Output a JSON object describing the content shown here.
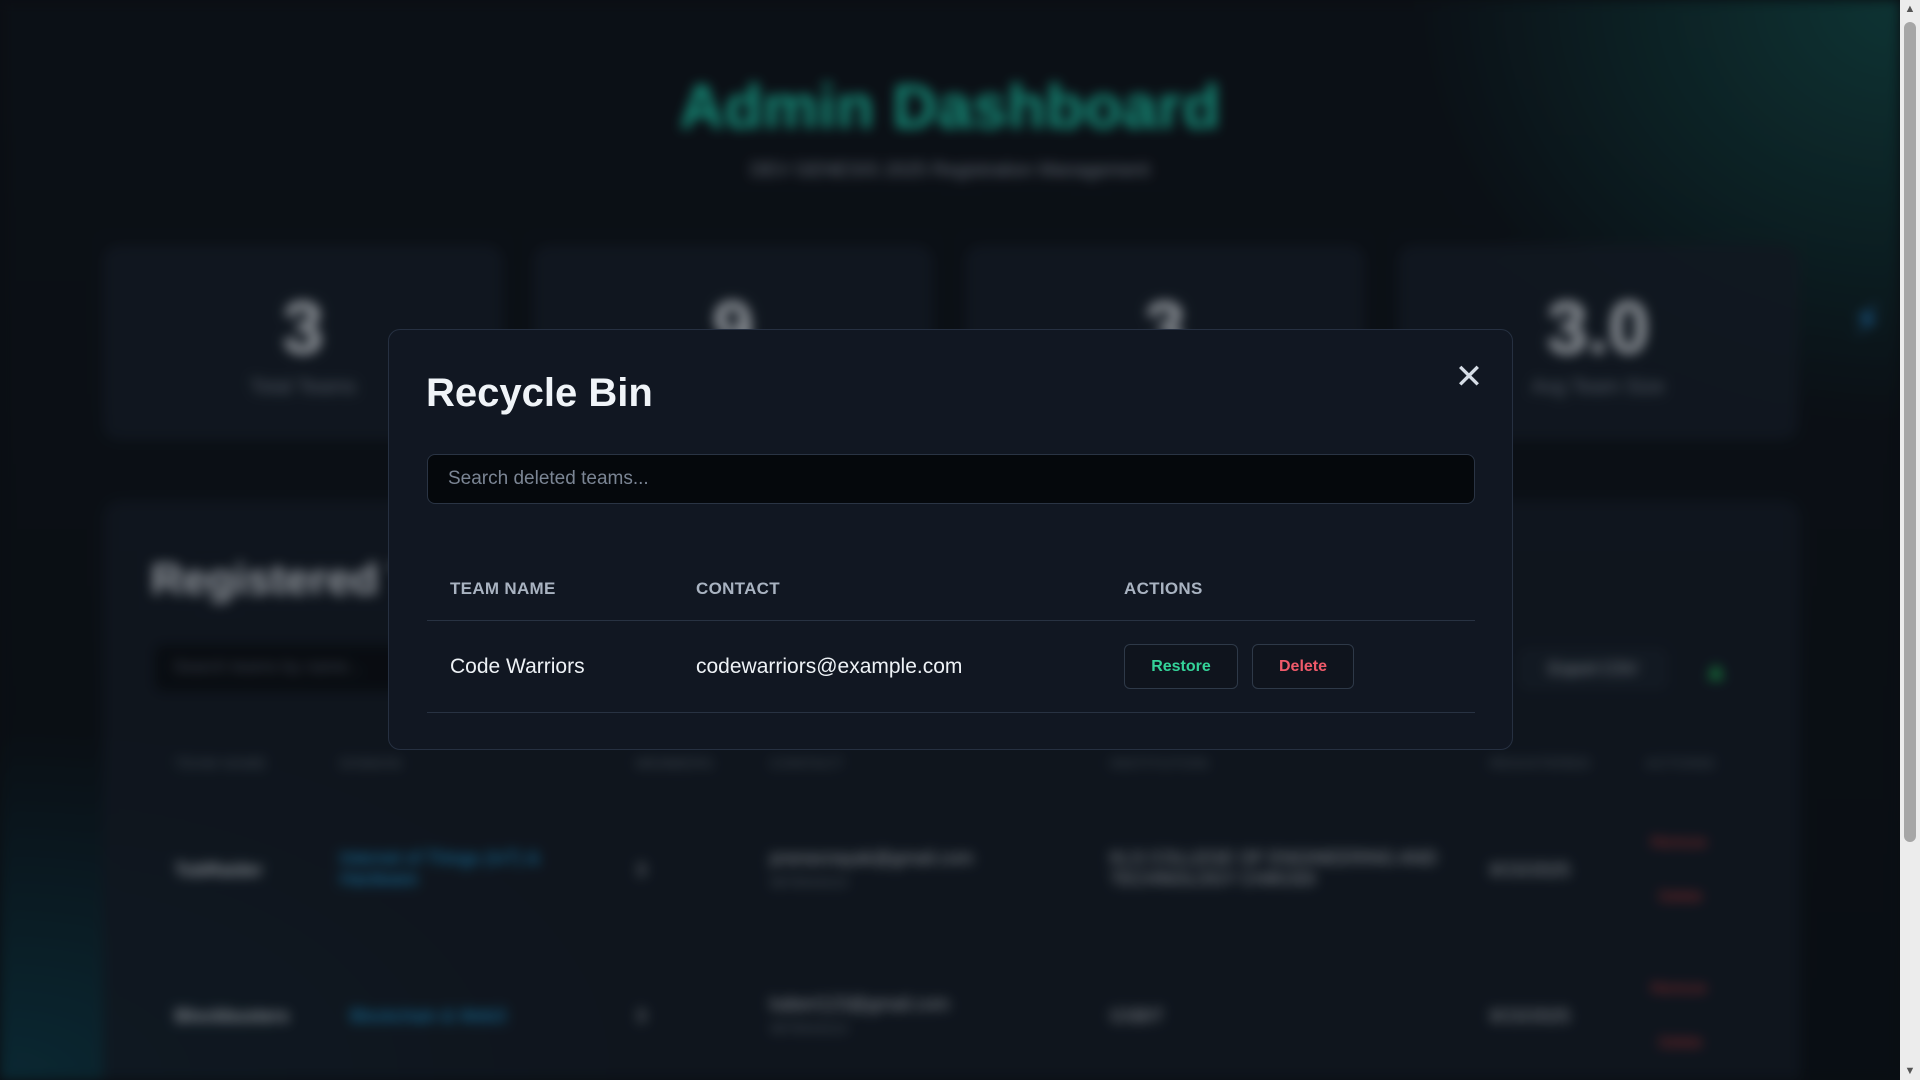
{
  "background": {
    "title": "Admin Dashboard",
    "subtitle": "DEV GENESIS 2025 Registration Management",
    "stats": [
      {
        "value": "3",
        "label": "Total Teams"
      },
      {
        "value": "9",
        "label": ""
      },
      {
        "value": "3",
        "label": ""
      },
      {
        "value": "3.0",
        "label": "Avg Team Size"
      }
    ],
    "section_heading": "Registered T",
    "search_placeholder": "Search teams by name...",
    "export_label": "Export CSV",
    "table_headers": [
      "TEAM NAME",
      "DOMAIN",
      "MEMBERS",
      "CONTACT",
      "INSTITUTION",
      "REGISTERED",
      "ACTIONS"
    ],
    "rows": [
      {
        "team": "TubRaider",
        "domain": "Internet of Things (IoT) & Hardware",
        "members": "3",
        "email": "pranavnayak@gmail.com",
        "phone": "9876543210",
        "institution": "KLS COLLEGE OF ENGINEERING AND TECHNOLOGY CHIKODI",
        "registered": "8/15/2025",
        "action1": "Remove",
        "action2": "Delete"
      },
      {
        "team": "Blockbusters",
        "domain": "Blockchain & Web3",
        "members": "3",
        "email": "kaberi123@gmail.com",
        "phone": "9876543210",
        "institution": "GSBIT",
        "registered": "8/15/2025",
        "action1": "Remove",
        "action2": "Delete"
      }
    ]
  },
  "modal": {
    "title": "Recycle Bin",
    "close_symbol": "✕",
    "search_placeholder": "Search deleted teams...",
    "columns": [
      "TEAM NAME",
      "CONTACT",
      "ACTIONS"
    ],
    "rows": [
      {
        "team_name": "Code Warriors",
        "contact": "codewarriors@example.com",
        "restore_label": "Restore",
        "delete_label": "Delete"
      }
    ]
  },
  "colors": {
    "accent_teal": "#1fd1b2",
    "restore_green": "#34d399",
    "delete_red": "#f05a6a",
    "modal_bg": "#111722"
  }
}
